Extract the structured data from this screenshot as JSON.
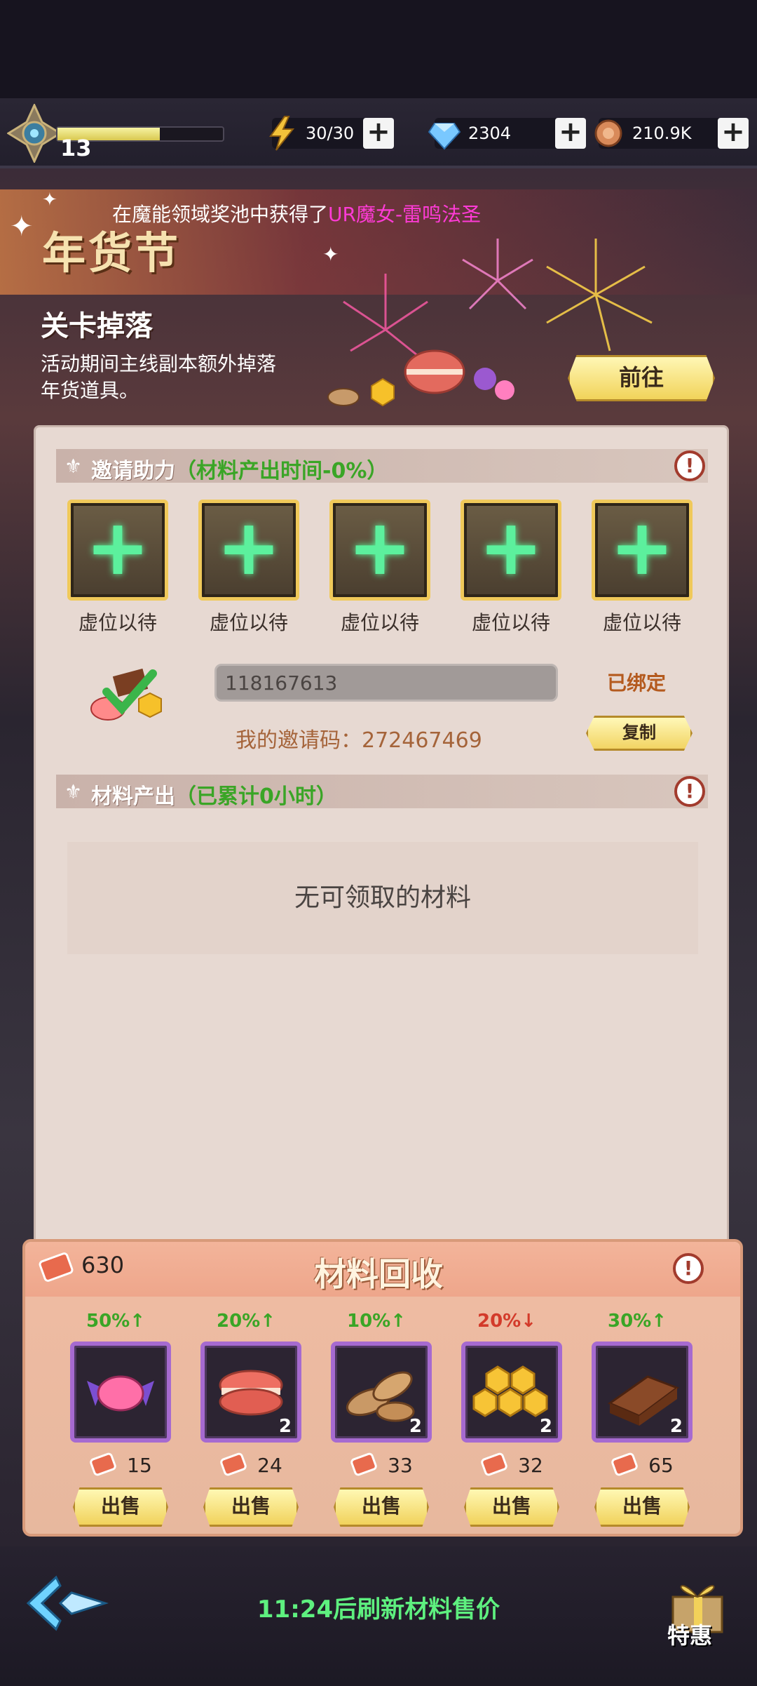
{
  "hud": {
    "level": "13",
    "energy": "30/30",
    "gems": "2304",
    "coins": "210.9K"
  },
  "banner": {
    "ticker_prefix": "在魔能领域奖池中获得了",
    "ticker_highlight": "UR魔女-雷鸣法圣",
    "event_title": "年货节",
    "drop_title": "关卡掉落",
    "drop_desc": "活动期间主线副本额外掉落年货道具。",
    "goto_label": "前往"
  },
  "invite": {
    "header": "邀请助力",
    "header_sub": "（材料产出时间-0%）",
    "slots": [
      {
        "label": "虚位以待"
      },
      {
        "label": "虚位以待"
      },
      {
        "label": "虚位以待"
      },
      {
        "label": "虚位以待"
      },
      {
        "label": "虚位以待"
      }
    ],
    "bound_code": "118167613",
    "bound_label": "已绑定",
    "my_code_label": "我的邀请码：272467469",
    "copy_label": "复制"
  },
  "output": {
    "header": "材料产出",
    "header_sub": "（已累计0小时）",
    "empty_text": "无可领取的材料"
  },
  "recycle": {
    "title": "材料回收",
    "tickets": "630",
    "items": [
      {
        "name": "candy",
        "pct": "50%↑",
        "trend": "up",
        "count": "",
        "price": "15",
        "sell": "出售"
      },
      {
        "name": "macaron",
        "pct": "20%↑",
        "trend": "up",
        "count": "2",
        "price": "24",
        "sell": "出售"
      },
      {
        "name": "almond",
        "pct": "10%↑",
        "trend": "up",
        "count": "2",
        "price": "33",
        "sell": "出售"
      },
      {
        "name": "honeycomb",
        "pct": "20%↓",
        "trend": "down",
        "count": "2",
        "price": "32",
        "sell": "出售"
      },
      {
        "name": "chocolate",
        "pct": "30%↑",
        "trend": "up",
        "count": "2",
        "price": "65",
        "sell": "出售"
      }
    ]
  },
  "footer": {
    "refresh_text": "11:24后刷新材料售价",
    "special_label": "特惠"
  },
  "colors": {
    "up": "#3aa526",
    "down": "#d33a2a",
    "accent_gold": "#f0c95a",
    "purple_frame": "#a66ad0"
  }
}
